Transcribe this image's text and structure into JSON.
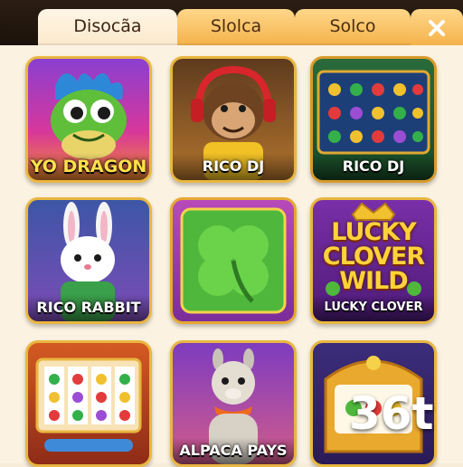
{
  "tabs": [
    {
      "label": "Disocãa",
      "active": true
    },
    {
      "label": "Slolca",
      "active": false
    },
    {
      "label": "Solco",
      "active": false
    }
  ],
  "close_icon": "close-icon",
  "games": [
    {
      "label": "YO DRAGON",
      "art": "dragon"
    },
    {
      "label": "RICO DJ",
      "art": "monkey-headphones"
    },
    {
      "label": "RICO DJ",
      "art": "slot-reels"
    },
    {
      "label": "RICO RABBIT",
      "art": "rabbit"
    },
    {
      "label": "",
      "art": "four-leaf-clover"
    },
    {
      "label": "LUCKY CLOVER WILD",
      "title_art": [
        "LUCKY",
        "CLOVER",
        "WILD"
      ],
      "art": "crown-clover"
    },
    {
      "label": "",
      "art": "slot-machine"
    },
    {
      "label": "ALPACA PAYS",
      "art": "alpaca"
    },
    {
      "label": "",
      "art": "slot-machine-clover"
    }
  ],
  "corner_badge": "36t",
  "colors": {
    "tab": "#f4b24a",
    "active_tab": "#fbe9cc",
    "card_border": "#e9b640",
    "topbar": "#1b120b"
  }
}
